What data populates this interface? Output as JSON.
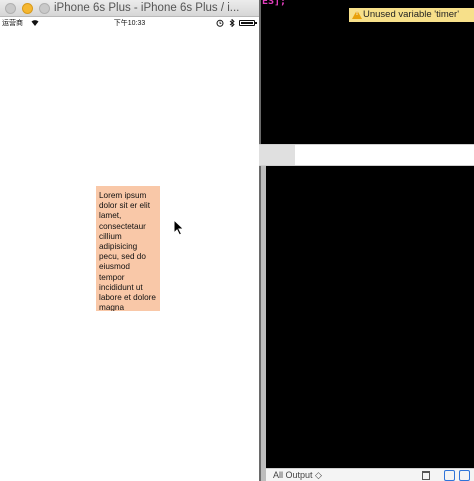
{
  "simulator": {
    "window_title": "iPhone 6s Plus - iPhone 6s Plus / i...",
    "status_bar": {
      "carrier": "运营商",
      "wifi_icon": "wifi-icon",
      "time": "下午10:33",
      "alarm_icon": "alarm-icon",
      "bluetooth_icon": "bluetooth-icon",
      "battery_icon": "battery-icon"
    },
    "lorem_text": "Lorem ipsum dolor sit er elit lamet, consectetaur cillium adipisicing pecu, sed do eiusmod tempor incididunt ut labore et dolore magna",
    "colors": {
      "lorem_background": "#f9c8a8"
    }
  },
  "xcode": {
    "code_snippet": "ES];",
    "warning": "Unused variable 'timer'",
    "debug_filter": "All Output ◇",
    "colors": {
      "warning_background": "#f7e08a",
      "editor_background": "#000000"
    }
  }
}
